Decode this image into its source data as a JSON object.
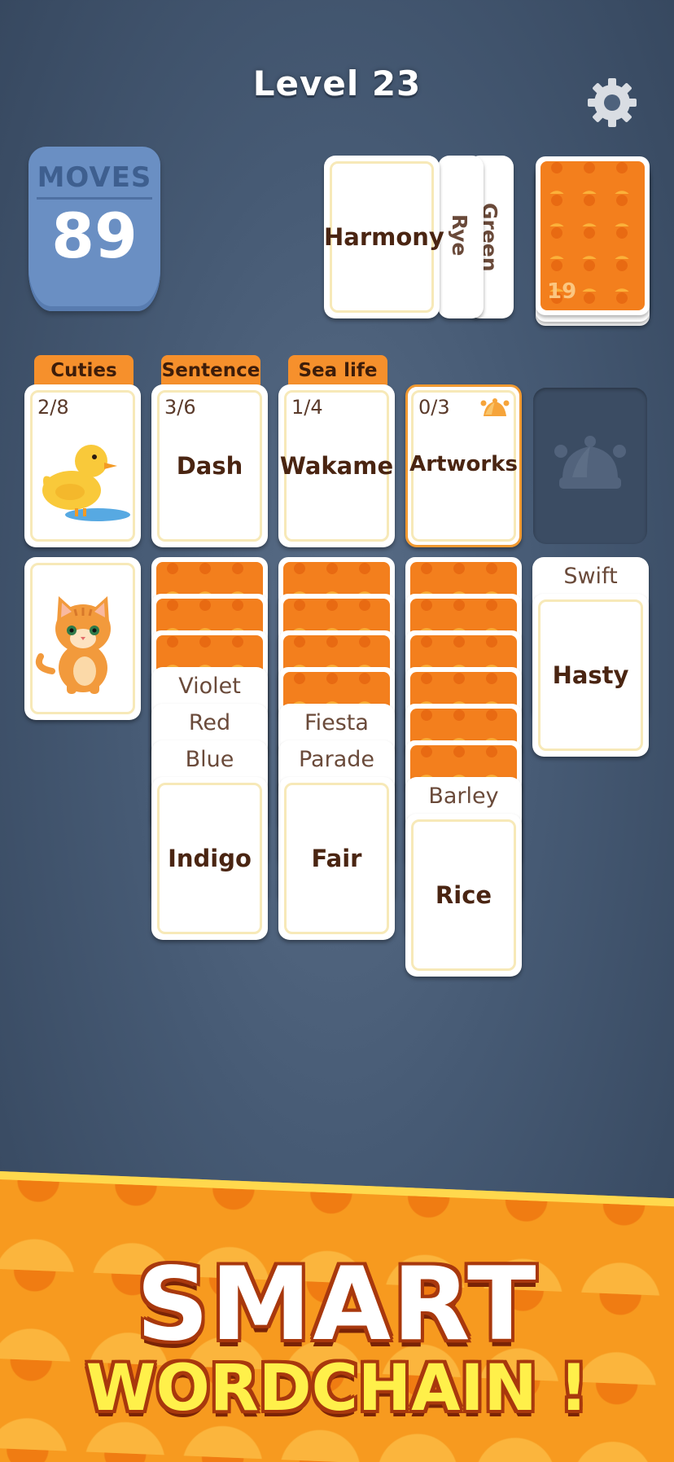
{
  "header": {
    "level_title": "Level 23",
    "settings_icon": "gear-icon"
  },
  "moves": {
    "label": "MOVES",
    "value": "89"
  },
  "waste_pile": {
    "top_card": "Harmony",
    "under_cards": [
      "Rye",
      "Green"
    ]
  },
  "deck": {
    "remaining": "19"
  },
  "foundations": [
    {
      "category": "Cuties",
      "progress": "2/8",
      "image": "duck-picture"
    },
    {
      "category": "Sentence",
      "progress": "3/6",
      "word": "Dash"
    },
    {
      "category": "Sea life",
      "progress": "1/4",
      "word": "Wakame"
    },
    {
      "category": "",
      "progress": "0/3",
      "word": "Artworks",
      "icon": "jester-hat-icon"
    },
    {
      "empty_slot_icon": "jester-hat-icon"
    }
  ],
  "tableau": [
    {
      "hidden_count": 0,
      "face_up": [],
      "top_image": "cat-picture"
    },
    {
      "hidden_count": 3,
      "face_up": [
        "Violet",
        "Red",
        "Blue"
      ],
      "top": "Indigo"
    },
    {
      "hidden_count": 4,
      "face_up": [
        "Fiesta",
        "Parade"
      ],
      "top": "Fair"
    },
    {
      "hidden_count": 6,
      "face_up": [
        "Barley"
      ],
      "top": "Rice"
    },
    {
      "hidden_count": 0,
      "face_up": [
        "Swift"
      ],
      "top": "Hasty"
    }
  ],
  "promo": {
    "line1": "SMART",
    "line2": "WORDCHAIN !"
  },
  "colors": {
    "background": "#465a74",
    "card_back": "#f37f1d",
    "category_tab": "#f6902c",
    "moves_badge": "#6a8fc3",
    "banner": "#f79a1f"
  }
}
